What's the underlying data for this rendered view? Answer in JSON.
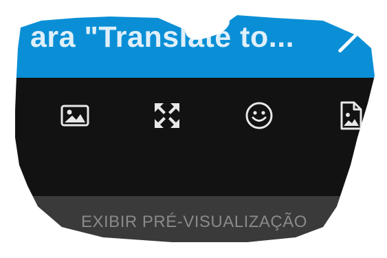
{
  "header": {
    "title": "ara \"Translate to...",
    "close_icon": "close-icon"
  },
  "toolbar": {
    "items": [
      {
        "name": "image-icon",
        "label": "image"
      },
      {
        "name": "fullscreen-icon",
        "label": "expand"
      },
      {
        "name": "emoji-icon",
        "label": "emoji"
      },
      {
        "name": "file-image-icon",
        "label": "file image"
      }
    ]
  },
  "preview": {
    "label": "EXIBIR PRÉ-VISUALIZAÇÃO"
  },
  "colors": {
    "header_bg": "#0a8fd6",
    "toolbar_bg": "#121212",
    "preview_bg": "#3a3a3a"
  }
}
